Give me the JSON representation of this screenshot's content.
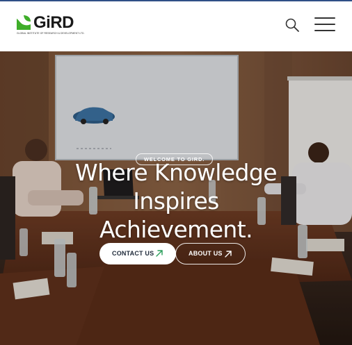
{
  "header": {
    "logo_text": "GiRD",
    "logo_tagline": "GLOBAL INSTITUTE OF RESEARCH & DEVELOPMENT LTD.",
    "search_icon": "search-icon",
    "menu_icon": "hamburger-menu-icon"
  },
  "hero": {
    "welcome_badge": "WELCOME TO GIRD.",
    "headline_line1": "Where Knowledge",
    "headline_line2": "Inspires",
    "headline_line3": "Achievement.",
    "background": "conference-room-photo"
  },
  "buttons": {
    "contact_label": "CONTACT US",
    "about_label": "ABOUT US",
    "arrow_icon": "arrow-up-right-icon"
  },
  "colors": {
    "brand_green": "#3fae2a",
    "topline": "#2f4f86",
    "contact_arrow": "#2a9d5a"
  }
}
